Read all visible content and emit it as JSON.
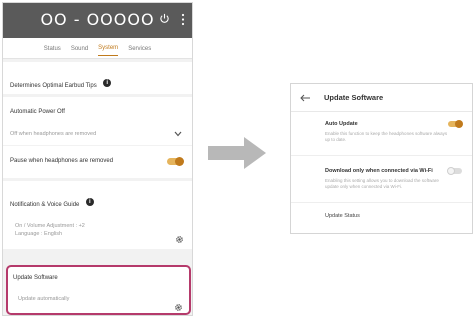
{
  "phone": {
    "device_name": "OO - OOOOO",
    "tabs": [
      {
        "label": "Status",
        "active": false
      },
      {
        "label": "Sound",
        "active": false
      },
      {
        "label": "System",
        "active": true
      },
      {
        "label": "Services",
        "active": false
      }
    ],
    "settings": {
      "optimal_earbud_tips": {
        "label": "Determines Optimal Earbud Tips"
      },
      "auto_power_off": {
        "label": "Automatic Power Off",
        "value": "Off when headphones are removed"
      },
      "pause_when_removed": {
        "label": "Pause when headphones are removed",
        "enabled": true
      },
      "notification_voice_guide": {
        "label": "Notification & Voice Guide",
        "detail_line1": "On / Volume Adjustment : +2",
        "detail_line2": "Language : English"
      },
      "update_software": {
        "label": "Update Software",
        "value": "Update automatically"
      }
    }
  },
  "dialog": {
    "title": "Update Software",
    "auto_update": {
      "label": "Auto Update",
      "desc": "Enable this function to keep the headphones software always up to date.",
      "enabled": true
    },
    "wifi_only": {
      "label": "Download only when connected via Wi-Fi",
      "desc": "Enabling this setting allows you to download the software update only when connected via Wi-Fi.",
      "enabled": false
    },
    "update_status": {
      "label": "Update Status"
    }
  },
  "colors": {
    "accent": "#c07a1c",
    "highlight_border": "#b53a6b",
    "topbar": "#5a5a5a",
    "arrow": "#b8b8b8"
  }
}
